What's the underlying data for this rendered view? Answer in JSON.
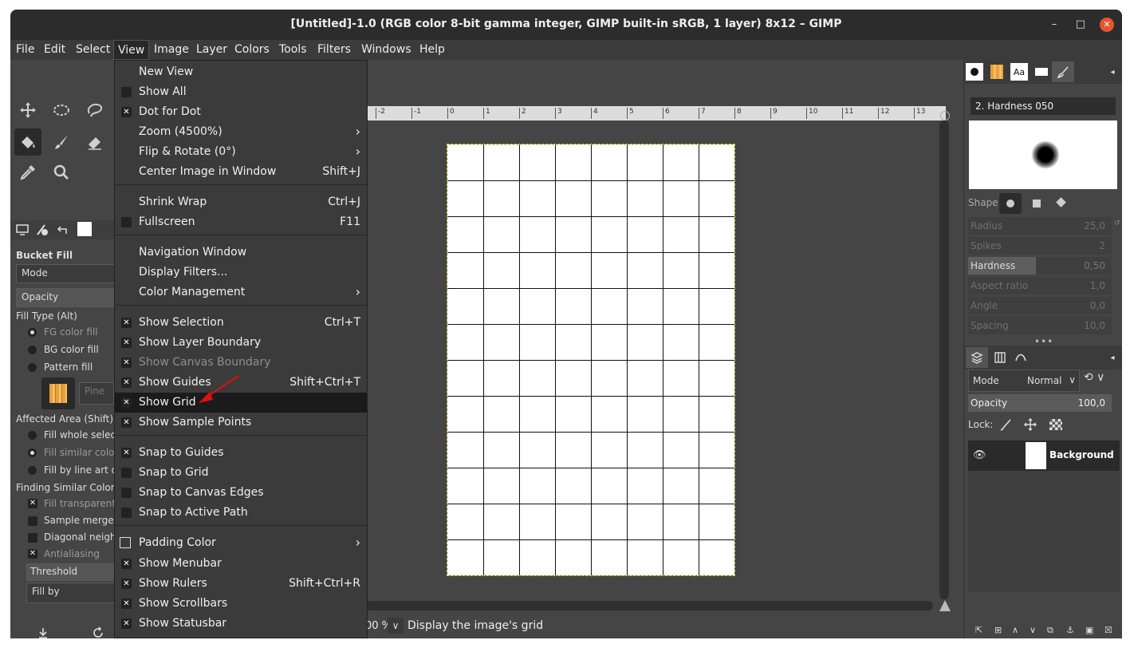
{
  "window": {
    "title": "[Untitled]-1.0 (RGB color 8-bit gamma integer, GIMP built-in sRGB, 1 layer) 8x12 – GIMP",
    "minimize_glyph": "–",
    "maximize_glyph": "□",
    "close_glyph": "✕"
  },
  "menubar": {
    "file": "File",
    "edit": "Edit",
    "select": "Select",
    "view": "View",
    "image": "Image",
    "layer": "Layer",
    "colors": "Colors",
    "tools": "Tools",
    "filters": "Filters",
    "windows": "Windows",
    "help": "Help"
  },
  "view_menu": {
    "new_view": "New View",
    "show_all": "Show All",
    "dot_for_dot": "Dot for Dot",
    "zoom": "Zoom (4500%)",
    "flip_rotate": "Flip & Rotate (0°)",
    "center_image": "Center Image in Window",
    "center_image_acc": "Shift+J",
    "shrink_wrap": "Shrink Wrap",
    "shrink_wrap_acc": "Ctrl+J",
    "fullscreen": "Fullscreen",
    "fullscreen_acc": "F11",
    "navigation_window": "Navigation Window",
    "display_filters": "Display Filters...",
    "color_management": "Color Management",
    "show_selection": "Show Selection",
    "show_selection_acc": "Ctrl+T",
    "show_layer_boundary": "Show Layer Boundary",
    "show_canvas_boundary": "Show Canvas Boundary",
    "show_guides": "Show Guides",
    "show_guides_acc": "Shift+Ctrl+T",
    "show_grid": "Show Grid",
    "show_sample_points": "Show Sample Points",
    "snap_to_guides": "Snap to Guides",
    "snap_to_grid": "Snap to Grid",
    "snap_to_canvas_edges": "Snap to Canvas Edges",
    "snap_to_active_path": "Snap to Active Path",
    "padding_color": "Padding Color",
    "show_menubar": "Show Menubar",
    "show_rulers": "Show Rulers",
    "show_rulers_acc": "Shift+Ctrl+R",
    "show_scrollbars": "Show Scrollbars",
    "show_statusbar": "Show Statusbar"
  },
  "tool_options": {
    "title": "Bucket Fill",
    "mode": "Mode",
    "opacity": "Opacity",
    "fill_type": "Fill Type  (Alt)",
    "fg_fill": "FG color fill",
    "bg_fill": "BG color fill",
    "pattern_fill": "Pattern fill",
    "pattern_name": "Pine",
    "affected_area": "Affected Area  (Shift)",
    "fill_whole": "Fill whole select",
    "fill_similar": "Fill similar color",
    "fill_line_art": "Fill by line art de",
    "finding_similar": "Finding Similar Colors",
    "fill_transparent": "Fill transparent",
    "sample_merged": "Sample merged",
    "diagonal": "Diagonal neigh",
    "antialiasing": "Antialiasing",
    "threshold": "Threshold",
    "fill_by": "Fill by"
  },
  "ruler": {
    "ticks": [
      "-2",
      "-1",
      "0",
      "1",
      "2",
      "3",
      "4",
      "5",
      "6",
      "7",
      "8",
      "9",
      "10",
      "11",
      "12",
      "13"
    ]
  },
  "statusbar": {
    "zoom_suffix": "00 %",
    "message": "Display the image's grid"
  },
  "brushes": {
    "brush_name": "2. Hardness 050",
    "shape_label": "Shape:",
    "tab_font": "Aa",
    "radius": "Radius",
    "radius_val": "25,0",
    "spikes": "Spikes",
    "spikes_val": "2",
    "hardness": "Hardness",
    "hardness_val": "0,50",
    "aspect": "Aspect ratio",
    "aspect_val": "1,0",
    "angle": "Angle",
    "angle_val": "0,0",
    "spacing": "Spacing",
    "spacing_val": "10,0"
  },
  "layers": {
    "mode_label": "Mode",
    "mode_value": "Normal",
    "opacity_label": "Opacity",
    "opacity_value": "100,0",
    "lock_label": "Lock:",
    "layer_name": "Background"
  }
}
